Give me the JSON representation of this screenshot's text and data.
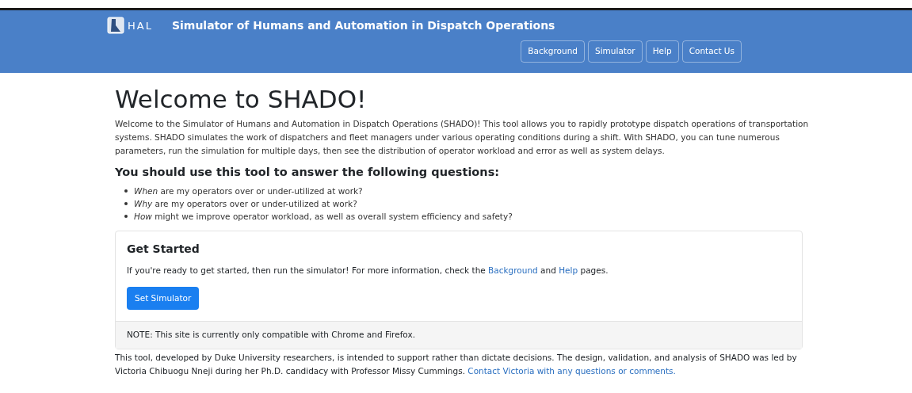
{
  "header": {
    "logo_text": "HAL",
    "title": "Simulator of Humans and Automation in Dispatch Operations",
    "nav": [
      {
        "label": "Background"
      },
      {
        "label": "Simulator"
      },
      {
        "label": "Help"
      },
      {
        "label": "Contact Us"
      }
    ]
  },
  "heading": "Welcome to SHADO!",
  "intro": "Welcome to the Simulator of Humans and Automation in Dispatch Operations (SHADO)! This tool allows you to rapidly prototype dispatch operations of transportation systems. SHADO simulates the work of dispatchers and fleet managers under various operating conditions during a shift. With SHADO, you can tune numerous parameters, run the simulation for multiple days, then see the distribution of operator workload and error as well as system delays.",
  "subheading": "You should use this tool to answer the following questions:",
  "questions": [
    "*When* are my operators over or under-utilized at work?",
    "*Why* are my operators over or under-utilized at work?",
    "*How* might we improve operator workload, as well as overall system efficiency and safety?"
  ],
  "card": {
    "title": "Get Started",
    "text": [
      {
        "kind": "plain",
        "text": "If you're ready to get started, then run the simulator! For more information, check the"
      },
      {
        "kind": "link",
        "text": "Background"
      },
      {
        "kind": "plain",
        "text": "and"
      },
      {
        "kind": "link",
        "text": "Help"
      },
      {
        "kind": "plain",
        "text": "pages."
      }
    ],
    "button": "Set Simulator",
    "footer": "NOTE: This site is currently only compatible with Chrome and Firefox."
  },
  "disclaimer": [
    {
      "kind": "plain",
      "text": "This tool, developed by Duke University researchers, is intended to support rather than dictate decisions. The design, validation, and analysis of SHADO was led by Victoria Chibuogu Nneji during her Ph.D. candidacy with Professor Missy Cummings."
    },
    {
      "kind": "link",
      "text": "Contact Victoria with any questions or comments."
    }
  ]
}
